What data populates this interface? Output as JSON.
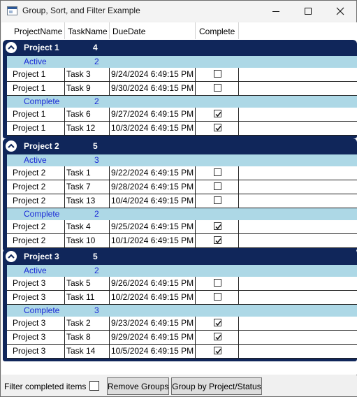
{
  "window": {
    "title": "Group, Sort, and Filter Example"
  },
  "columns": [
    "ProjectName",
    "TaskName",
    "DueDate",
    "Complete"
  ],
  "groups": [
    {
      "name": "Project 1",
      "count": "4",
      "subgroups": [
        {
          "name": "Active",
          "count": "2",
          "rows": [
            {
              "project": "Project 1",
              "task": "Task 3",
              "due": "9/24/2024 6:49:15 PM",
              "complete": false
            },
            {
              "project": "Project 1",
              "task": "Task 9",
              "due": "9/30/2024 6:49:15 PM",
              "complete": false
            }
          ]
        },
        {
          "name": "Complete",
          "count": "2",
          "rows": [
            {
              "project": "Project 1",
              "task": "Task 6",
              "due": "9/27/2024 6:49:15 PM",
              "complete": true
            },
            {
              "project": "Project 1",
              "task": "Task 12",
              "due": "10/3/2024 6:49:15 PM",
              "complete": true
            }
          ]
        }
      ]
    },
    {
      "name": "Project 2",
      "count": "5",
      "subgroups": [
        {
          "name": "Active",
          "count": "3",
          "rows": [
            {
              "project": "Project 2",
              "task": "Task 1",
              "due": "9/22/2024 6:49:15 PM",
              "complete": false
            },
            {
              "project": "Project 2",
              "task": "Task 7",
              "due": "9/28/2024 6:49:15 PM",
              "complete": false
            },
            {
              "project": "Project 2",
              "task": "Task 13",
              "due": "10/4/2024 6:49:15 PM",
              "complete": false
            }
          ]
        },
        {
          "name": "Complete",
          "count": "2",
          "rows": [
            {
              "project": "Project 2",
              "task": "Task 4",
              "due": "9/25/2024 6:49:15 PM",
              "complete": true
            },
            {
              "project": "Project 2",
              "task": "Task 10",
              "due": "10/1/2024 6:49:15 PM",
              "complete": true
            }
          ]
        }
      ]
    },
    {
      "name": "Project 3",
      "count": "5",
      "subgroups": [
        {
          "name": "Active",
          "count": "2",
          "rows": [
            {
              "project": "Project 3",
              "task": "Task 5",
              "due": "9/26/2024 6:49:15 PM",
              "complete": false
            },
            {
              "project": "Project 3",
              "task": "Task 11",
              "due": "10/2/2024 6:49:15 PM",
              "complete": false
            }
          ]
        },
        {
          "name": "Complete",
          "count": "3",
          "rows": [
            {
              "project": "Project 3",
              "task": "Task 2",
              "due": "9/23/2024 6:49:15 PM",
              "complete": true
            },
            {
              "project": "Project 3",
              "task": "Task 8",
              "due": "9/29/2024 6:49:15 PM",
              "complete": true
            },
            {
              "project": "Project 3",
              "task": "Task 14",
              "due": "10/5/2024 6:49:15 PM",
              "complete": true
            }
          ]
        }
      ]
    }
  ],
  "footer": {
    "filter_label": "Filter completed items",
    "filter_checked": false,
    "remove_groups_label": "Remove Groups",
    "group_by_label": "Group by Project/Status"
  },
  "colors": {
    "group_header": "#10265a",
    "subgroup_header": "#add8e6",
    "subgroup_text": "#1a2bd6"
  },
  "icons": {
    "app": "window-icon",
    "expander": "chevron-up-icon",
    "check": "checkmark-icon"
  }
}
